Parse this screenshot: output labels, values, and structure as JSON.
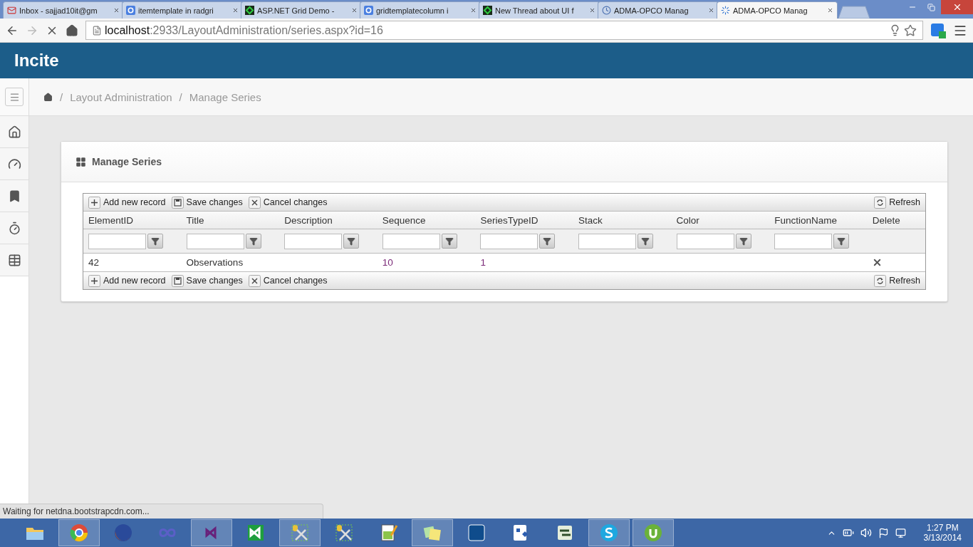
{
  "browser": {
    "tabs": [
      {
        "title": "Inbox - sajjad10it@gm",
        "kind": "mail",
        "selected": false
      },
      {
        "title": "itemtemplate in radgri",
        "kind": "g",
        "selected": false
      },
      {
        "title": "ASP.NET Grid Demo -",
        "kind": "telerik",
        "selected": false
      },
      {
        "title": "gridtemplatecolumn i",
        "kind": "g",
        "selected": false
      },
      {
        "title": "New Thread about UI f",
        "kind": "telerik",
        "selected": false
      },
      {
        "title": "ADMA-OPCO Manag",
        "kind": "clock",
        "selected": false
      },
      {
        "title": "ADMA-OPCO Manag",
        "kind": "loading",
        "selected": true
      }
    ],
    "address": {
      "host": "localhost",
      "path": ":2933/LayoutAdministration/series.aspx?id=16"
    },
    "forward_disabled": true,
    "status": "Waiting for netdna.bootstrapcdn.com..."
  },
  "app": {
    "brand": "Incite",
    "breadcrumb": [
      {
        "separator": "/",
        "label": "Layout Administration"
      },
      {
        "separator": "/",
        "label": "Manage Series"
      }
    ],
    "sidebar": [
      {
        "kind": "home",
        "selected": false
      },
      {
        "kind": "gauge",
        "selected": false
      },
      {
        "kind": "bookmark",
        "selected": false
      },
      {
        "kind": "timer",
        "selected": false
      },
      {
        "kind": "table",
        "selected": false
      }
    ],
    "panel": {
      "title": "Manage Series",
      "top_toolbar": {
        "buttons": [
          {
            "label": "Add new record",
            "kind": "add"
          },
          {
            "label": "Save changes",
            "kind": "disk"
          },
          {
            "label": "Cancel changes",
            "kind": "cross"
          }
        ],
        "refresh": "Refresh"
      },
      "columns": [
        {
          "title": "ElementID",
          "kind": "filtered"
        },
        {
          "title": "Title",
          "kind": "filtered"
        },
        {
          "title": "Description",
          "kind": "filtered"
        },
        {
          "title": "Sequence",
          "kind": "filtered"
        },
        {
          "title": "SeriesTypeID",
          "kind": "filtered"
        },
        {
          "title": "Stack",
          "kind": "filtered"
        },
        {
          "title": "Color",
          "kind": "filtered"
        },
        {
          "title": "FunctionName",
          "kind": "filtered"
        },
        {
          "title": "Delete",
          "kind": "action"
        }
      ],
      "rows": [
        {
          "cells": [
            {
              "kind": "text",
              "text": "42"
            },
            {
              "kind": "text",
              "text": "Observations"
            },
            {
              "kind": "empty"
            },
            {
              "kind": "number",
              "text": "10"
            },
            {
              "kind": "number",
              "text": "1"
            },
            {
              "kind": "empty"
            },
            {
              "kind": "empty"
            },
            {
              "kind": "empty"
            },
            {
              "kind": "delete"
            }
          ]
        }
      ],
      "bottom_toolbar": {
        "buttons": [
          {
            "label": "Add new record",
            "kind": "add"
          },
          {
            "label": "Save changes",
            "kind": "disk"
          },
          {
            "label": "Cancel changes",
            "kind": "cross"
          }
        ],
        "refresh": "Refresh"
      }
    }
  },
  "taskbar": {
    "apps": [
      {
        "kind": "folder",
        "active": false
      },
      {
        "kind": "chrome",
        "active": true
      },
      {
        "kind": "firefox",
        "active": false
      },
      {
        "kind": "infinity",
        "active": false
      },
      {
        "kind": "studio",
        "active": true
      },
      {
        "kind": "studio-green",
        "active": false
      },
      {
        "kind": "tools",
        "active": true
      },
      {
        "kind": "tools",
        "active": false
      },
      {
        "kind": "notepad",
        "active": false
      },
      {
        "kind": "notes",
        "active": true
      },
      {
        "kind": "photo",
        "active": false
      },
      {
        "kind": "diagram",
        "active": false
      },
      {
        "kind": "planner",
        "active": false
      },
      {
        "kind": "chat",
        "active": true
      },
      {
        "kind": "torrent",
        "active": true
      }
    ],
    "time": "1:27 PM",
    "date": "3/13/2014"
  }
}
